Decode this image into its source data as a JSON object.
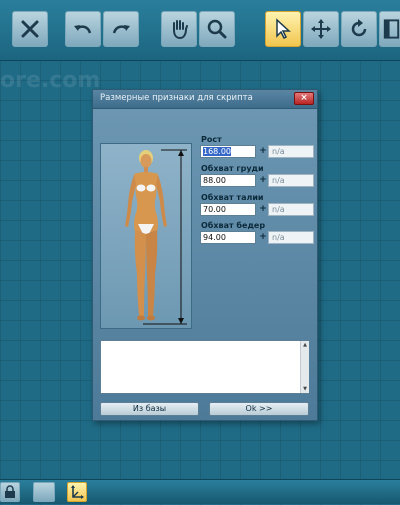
{
  "toolbar": {
    "buttons": [
      {
        "icon": "close-x-icon"
      },
      {
        "icon": "undo-icon"
      },
      {
        "icon": "redo-icon"
      },
      {
        "icon": "hand-pan-icon"
      },
      {
        "icon": "magnifier-icon"
      },
      {
        "icon": "arrow-select-icon",
        "active": true
      },
      {
        "icon": "move-cross-icon"
      },
      {
        "icon": "rotate-icon"
      },
      {
        "icon": "panel-icon"
      }
    ]
  },
  "watermark": "ore.com",
  "dialog": {
    "title": "Размерные признаки для скрипта",
    "close_label": "×",
    "fields": [
      {
        "label": "Рост",
        "value": "168.00",
        "plus": "+",
        "na": "n/a",
        "selected": true
      },
      {
        "label": "Обхват груди",
        "value": "88.00",
        "plus": "+",
        "na": "n/a"
      },
      {
        "label": "Обхват талии",
        "value": "70.00",
        "plus": "+",
        "na": "n/a"
      },
      {
        "label": "Обхват бедер",
        "value": "94.00",
        "plus": "+",
        "na": "n/a"
      }
    ],
    "notes_value": "",
    "from_db_label": "Из базы",
    "ok_label": "Ok >>"
  },
  "bottombar": {
    "buttons": [
      {
        "icon": "lock-icon"
      },
      {
        "icon": "blank-icon"
      },
      {
        "icon": "blank-icon"
      },
      {
        "icon": "axis-icon",
        "active": true
      }
    ]
  },
  "colors": {
    "background": "#1f6b86",
    "active_button": "#f1c64f",
    "close_button": "#b82424",
    "selection": "#3568c8"
  }
}
